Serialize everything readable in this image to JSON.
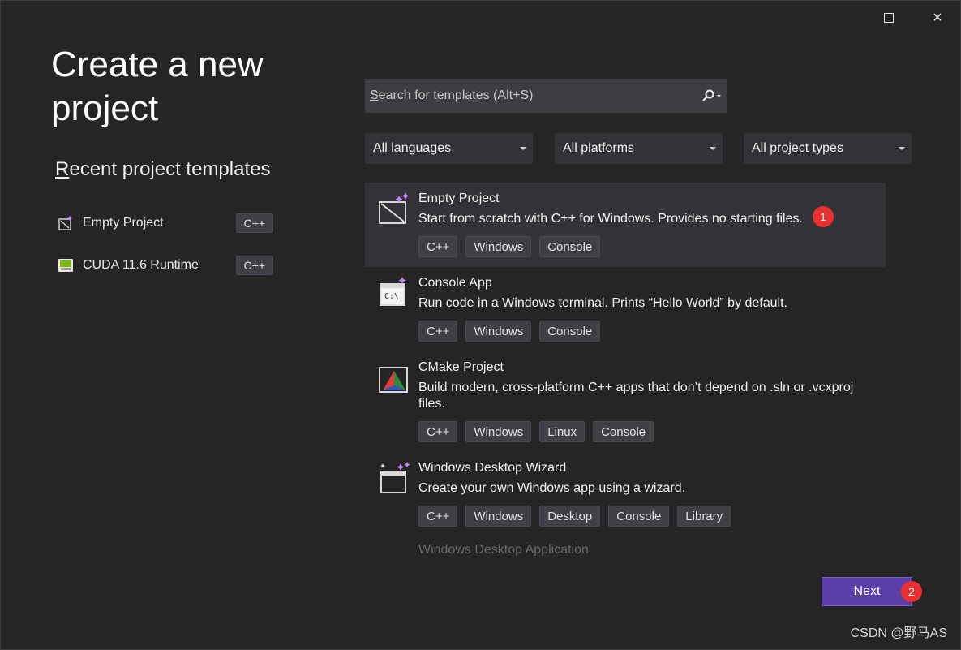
{
  "window": {
    "maximize": "maximize",
    "close": "✕"
  },
  "page_title": "Create a new project",
  "recent": {
    "heading_first": "R",
    "heading_rest": "ecent project templates",
    "items": [
      {
        "label": "Empty Project",
        "tag": "C++",
        "icon": "empty-project-icon"
      },
      {
        "label": "CUDA 11.6 Runtime",
        "tag": "C++",
        "icon": "cuda-icon"
      }
    ]
  },
  "search": {
    "placeholder_first": "S",
    "placeholder_rest": "earch for templates (Alt+S)"
  },
  "filters": [
    {
      "pre": "All ",
      "u": "l",
      "post": "anguages"
    },
    {
      "pre": "All ",
      "u": "p",
      "post": "latforms"
    },
    {
      "pre": "All project types",
      "u": "",
      "post": ""
    }
  ],
  "templates": [
    {
      "name": "Empty Project",
      "desc": "Start from scratch with C++ for Windows. Provides no starting files.",
      "tags": [
        "C++",
        "Windows",
        "Console"
      ],
      "icon": "empty-project-icon",
      "selected": true
    },
    {
      "name": "Console App",
      "desc": "Run code in a Windows terminal. Prints “Hello World” by default.",
      "tags": [
        "C++",
        "Windows",
        "Console"
      ],
      "icon": "console-app-icon"
    },
    {
      "name": "CMake Project",
      "desc": "Build modern, cross-platform C++ apps that don’t depend on .sln or .vcxproj files.",
      "tags": [
        "C++",
        "Windows",
        "Linux",
        "Console"
      ],
      "icon": "cmake-icon"
    },
    {
      "name": "Windows Desktop Wizard",
      "desc": "Create your own Windows app using a wizard.",
      "tags": [
        "C++",
        "Windows",
        "Desktop",
        "Console",
        "Library"
      ],
      "icon": "wizard-icon"
    }
  ],
  "partial_template": "Windows Desktop Application",
  "next_button": {
    "first": "N",
    "rest": "ext"
  },
  "markers": [
    "1",
    "2"
  ],
  "watermark": "CSDN @野马AS",
  "colors": {
    "accent": "#5b3ea8",
    "marker": "#e8312e",
    "background": "#252526"
  }
}
